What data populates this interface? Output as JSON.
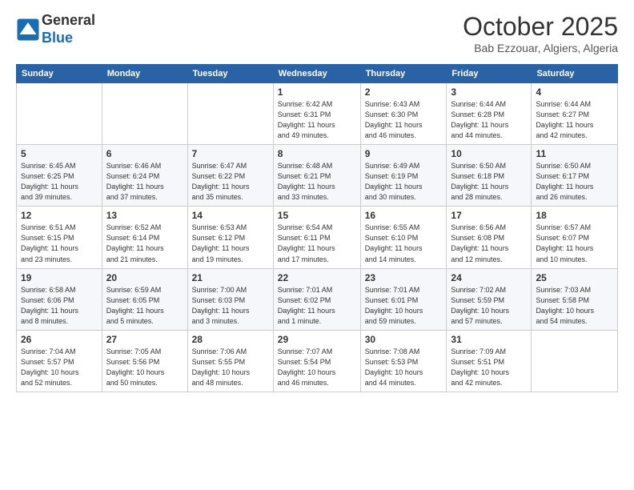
{
  "header": {
    "logo_line1": "General",
    "logo_line2": "Blue",
    "month": "October 2025",
    "location": "Bab Ezzouar, Algiers, Algeria"
  },
  "weekdays": [
    "Sunday",
    "Monday",
    "Tuesday",
    "Wednesday",
    "Thursday",
    "Friday",
    "Saturday"
  ],
  "weeks": [
    [
      {
        "day": "",
        "info": ""
      },
      {
        "day": "",
        "info": ""
      },
      {
        "day": "",
        "info": ""
      },
      {
        "day": "1",
        "info": "Sunrise: 6:42 AM\nSunset: 6:31 PM\nDaylight: 11 hours\nand 49 minutes."
      },
      {
        "day": "2",
        "info": "Sunrise: 6:43 AM\nSunset: 6:30 PM\nDaylight: 11 hours\nand 46 minutes."
      },
      {
        "day": "3",
        "info": "Sunrise: 6:44 AM\nSunset: 6:28 PM\nDaylight: 11 hours\nand 44 minutes."
      },
      {
        "day": "4",
        "info": "Sunrise: 6:44 AM\nSunset: 6:27 PM\nDaylight: 11 hours\nand 42 minutes."
      }
    ],
    [
      {
        "day": "5",
        "info": "Sunrise: 6:45 AM\nSunset: 6:25 PM\nDaylight: 11 hours\nand 39 minutes."
      },
      {
        "day": "6",
        "info": "Sunrise: 6:46 AM\nSunset: 6:24 PM\nDaylight: 11 hours\nand 37 minutes."
      },
      {
        "day": "7",
        "info": "Sunrise: 6:47 AM\nSunset: 6:22 PM\nDaylight: 11 hours\nand 35 minutes."
      },
      {
        "day": "8",
        "info": "Sunrise: 6:48 AM\nSunset: 6:21 PM\nDaylight: 11 hours\nand 33 minutes."
      },
      {
        "day": "9",
        "info": "Sunrise: 6:49 AM\nSunset: 6:19 PM\nDaylight: 11 hours\nand 30 minutes."
      },
      {
        "day": "10",
        "info": "Sunrise: 6:50 AM\nSunset: 6:18 PM\nDaylight: 11 hours\nand 28 minutes."
      },
      {
        "day": "11",
        "info": "Sunrise: 6:50 AM\nSunset: 6:17 PM\nDaylight: 11 hours\nand 26 minutes."
      }
    ],
    [
      {
        "day": "12",
        "info": "Sunrise: 6:51 AM\nSunset: 6:15 PM\nDaylight: 11 hours\nand 23 minutes."
      },
      {
        "day": "13",
        "info": "Sunrise: 6:52 AM\nSunset: 6:14 PM\nDaylight: 11 hours\nand 21 minutes."
      },
      {
        "day": "14",
        "info": "Sunrise: 6:53 AM\nSunset: 6:12 PM\nDaylight: 11 hours\nand 19 minutes."
      },
      {
        "day": "15",
        "info": "Sunrise: 6:54 AM\nSunset: 6:11 PM\nDaylight: 11 hours\nand 17 minutes."
      },
      {
        "day": "16",
        "info": "Sunrise: 6:55 AM\nSunset: 6:10 PM\nDaylight: 11 hours\nand 14 minutes."
      },
      {
        "day": "17",
        "info": "Sunrise: 6:56 AM\nSunset: 6:08 PM\nDaylight: 11 hours\nand 12 minutes."
      },
      {
        "day": "18",
        "info": "Sunrise: 6:57 AM\nSunset: 6:07 PM\nDaylight: 11 hours\nand 10 minutes."
      }
    ],
    [
      {
        "day": "19",
        "info": "Sunrise: 6:58 AM\nSunset: 6:06 PM\nDaylight: 11 hours\nand 8 minutes."
      },
      {
        "day": "20",
        "info": "Sunrise: 6:59 AM\nSunset: 6:05 PM\nDaylight: 11 hours\nand 5 minutes."
      },
      {
        "day": "21",
        "info": "Sunrise: 7:00 AM\nSunset: 6:03 PM\nDaylight: 11 hours\nand 3 minutes."
      },
      {
        "day": "22",
        "info": "Sunrise: 7:01 AM\nSunset: 6:02 PM\nDaylight: 11 hours\nand 1 minute."
      },
      {
        "day": "23",
        "info": "Sunrise: 7:01 AM\nSunset: 6:01 PM\nDaylight: 10 hours\nand 59 minutes."
      },
      {
        "day": "24",
        "info": "Sunrise: 7:02 AM\nSunset: 5:59 PM\nDaylight: 10 hours\nand 57 minutes."
      },
      {
        "day": "25",
        "info": "Sunrise: 7:03 AM\nSunset: 5:58 PM\nDaylight: 10 hours\nand 54 minutes."
      }
    ],
    [
      {
        "day": "26",
        "info": "Sunrise: 7:04 AM\nSunset: 5:57 PM\nDaylight: 10 hours\nand 52 minutes."
      },
      {
        "day": "27",
        "info": "Sunrise: 7:05 AM\nSunset: 5:56 PM\nDaylight: 10 hours\nand 50 minutes."
      },
      {
        "day": "28",
        "info": "Sunrise: 7:06 AM\nSunset: 5:55 PM\nDaylight: 10 hours\nand 48 minutes."
      },
      {
        "day": "29",
        "info": "Sunrise: 7:07 AM\nSunset: 5:54 PM\nDaylight: 10 hours\nand 46 minutes."
      },
      {
        "day": "30",
        "info": "Sunrise: 7:08 AM\nSunset: 5:53 PM\nDaylight: 10 hours\nand 44 minutes."
      },
      {
        "day": "31",
        "info": "Sunrise: 7:09 AM\nSunset: 5:51 PM\nDaylight: 10 hours\nand 42 minutes."
      },
      {
        "day": "",
        "info": ""
      }
    ]
  ]
}
